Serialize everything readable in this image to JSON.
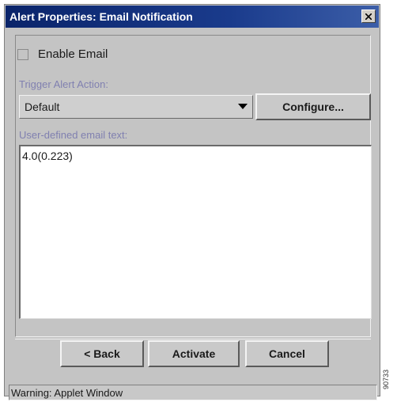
{
  "window": {
    "title": "Alert Properties: Email Notification"
  },
  "form": {
    "enable_email_label": "Enable Email",
    "enable_email_checked": false,
    "trigger_label": "Trigger Alert Action:",
    "trigger_value": "Default",
    "configure_label": "Configure...",
    "email_text_label": "User-defined email text:",
    "email_text_value": "4.0(0.223)"
  },
  "buttons": {
    "back": "< Back",
    "activate": "Activate",
    "cancel": "Cancel"
  },
  "status": {
    "text": "Warning: Applet Window"
  },
  "figure_id": "90733",
  "colors": {
    "title_bar": "#0a246a",
    "dialog_bg": "#c4c4c4",
    "label_text": "#8080b0"
  }
}
